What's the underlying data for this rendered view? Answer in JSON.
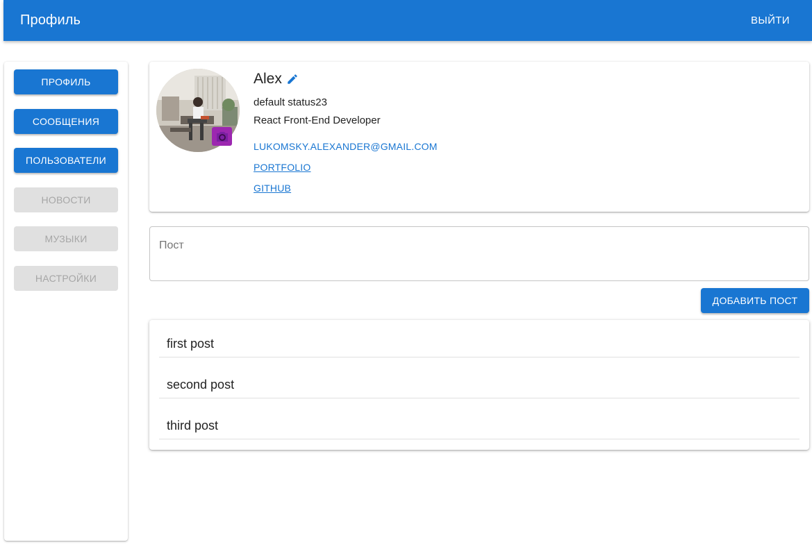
{
  "header": {
    "title": "Профиль",
    "logout_label": "ВЫЙТИ"
  },
  "sidebar": {
    "items": [
      {
        "label": "ПРОФИЛЬ",
        "enabled": true
      },
      {
        "label": "СООБЩЕНИЯ",
        "enabled": true
      },
      {
        "label": "ПОЛЬЗОВАТЕЛИ",
        "enabled": true
      },
      {
        "label": "НОВОСТИ",
        "enabled": false
      },
      {
        "label": "МУЗЫКИ",
        "enabled": false
      },
      {
        "label": "НАСТРОЙКИ",
        "enabled": false
      }
    ]
  },
  "profile": {
    "name": "Alex",
    "status": "default status23",
    "job": "React Front-End Developer",
    "email": "LUKOMSKY.ALEXANDER@GMAIL.COM",
    "links": [
      {
        "label": "PORTFOLIO"
      },
      {
        "label": "GITHUB"
      }
    ],
    "icons": {
      "edit": "pencil-icon",
      "upload": "camera-icon"
    }
  },
  "post_form": {
    "placeholder": "Пост",
    "value": "",
    "submit_label": "ДОБАВИТЬ ПОСТ"
  },
  "posts": [
    {
      "text": "first post"
    },
    {
      "text": "second post"
    },
    {
      "text": "third post"
    }
  ],
  "colors": {
    "primary": "#1976d2",
    "camera_button": "#9c27b0",
    "disabled_bg": "#e0e0e0",
    "disabled_text": "#a6a6a6"
  }
}
